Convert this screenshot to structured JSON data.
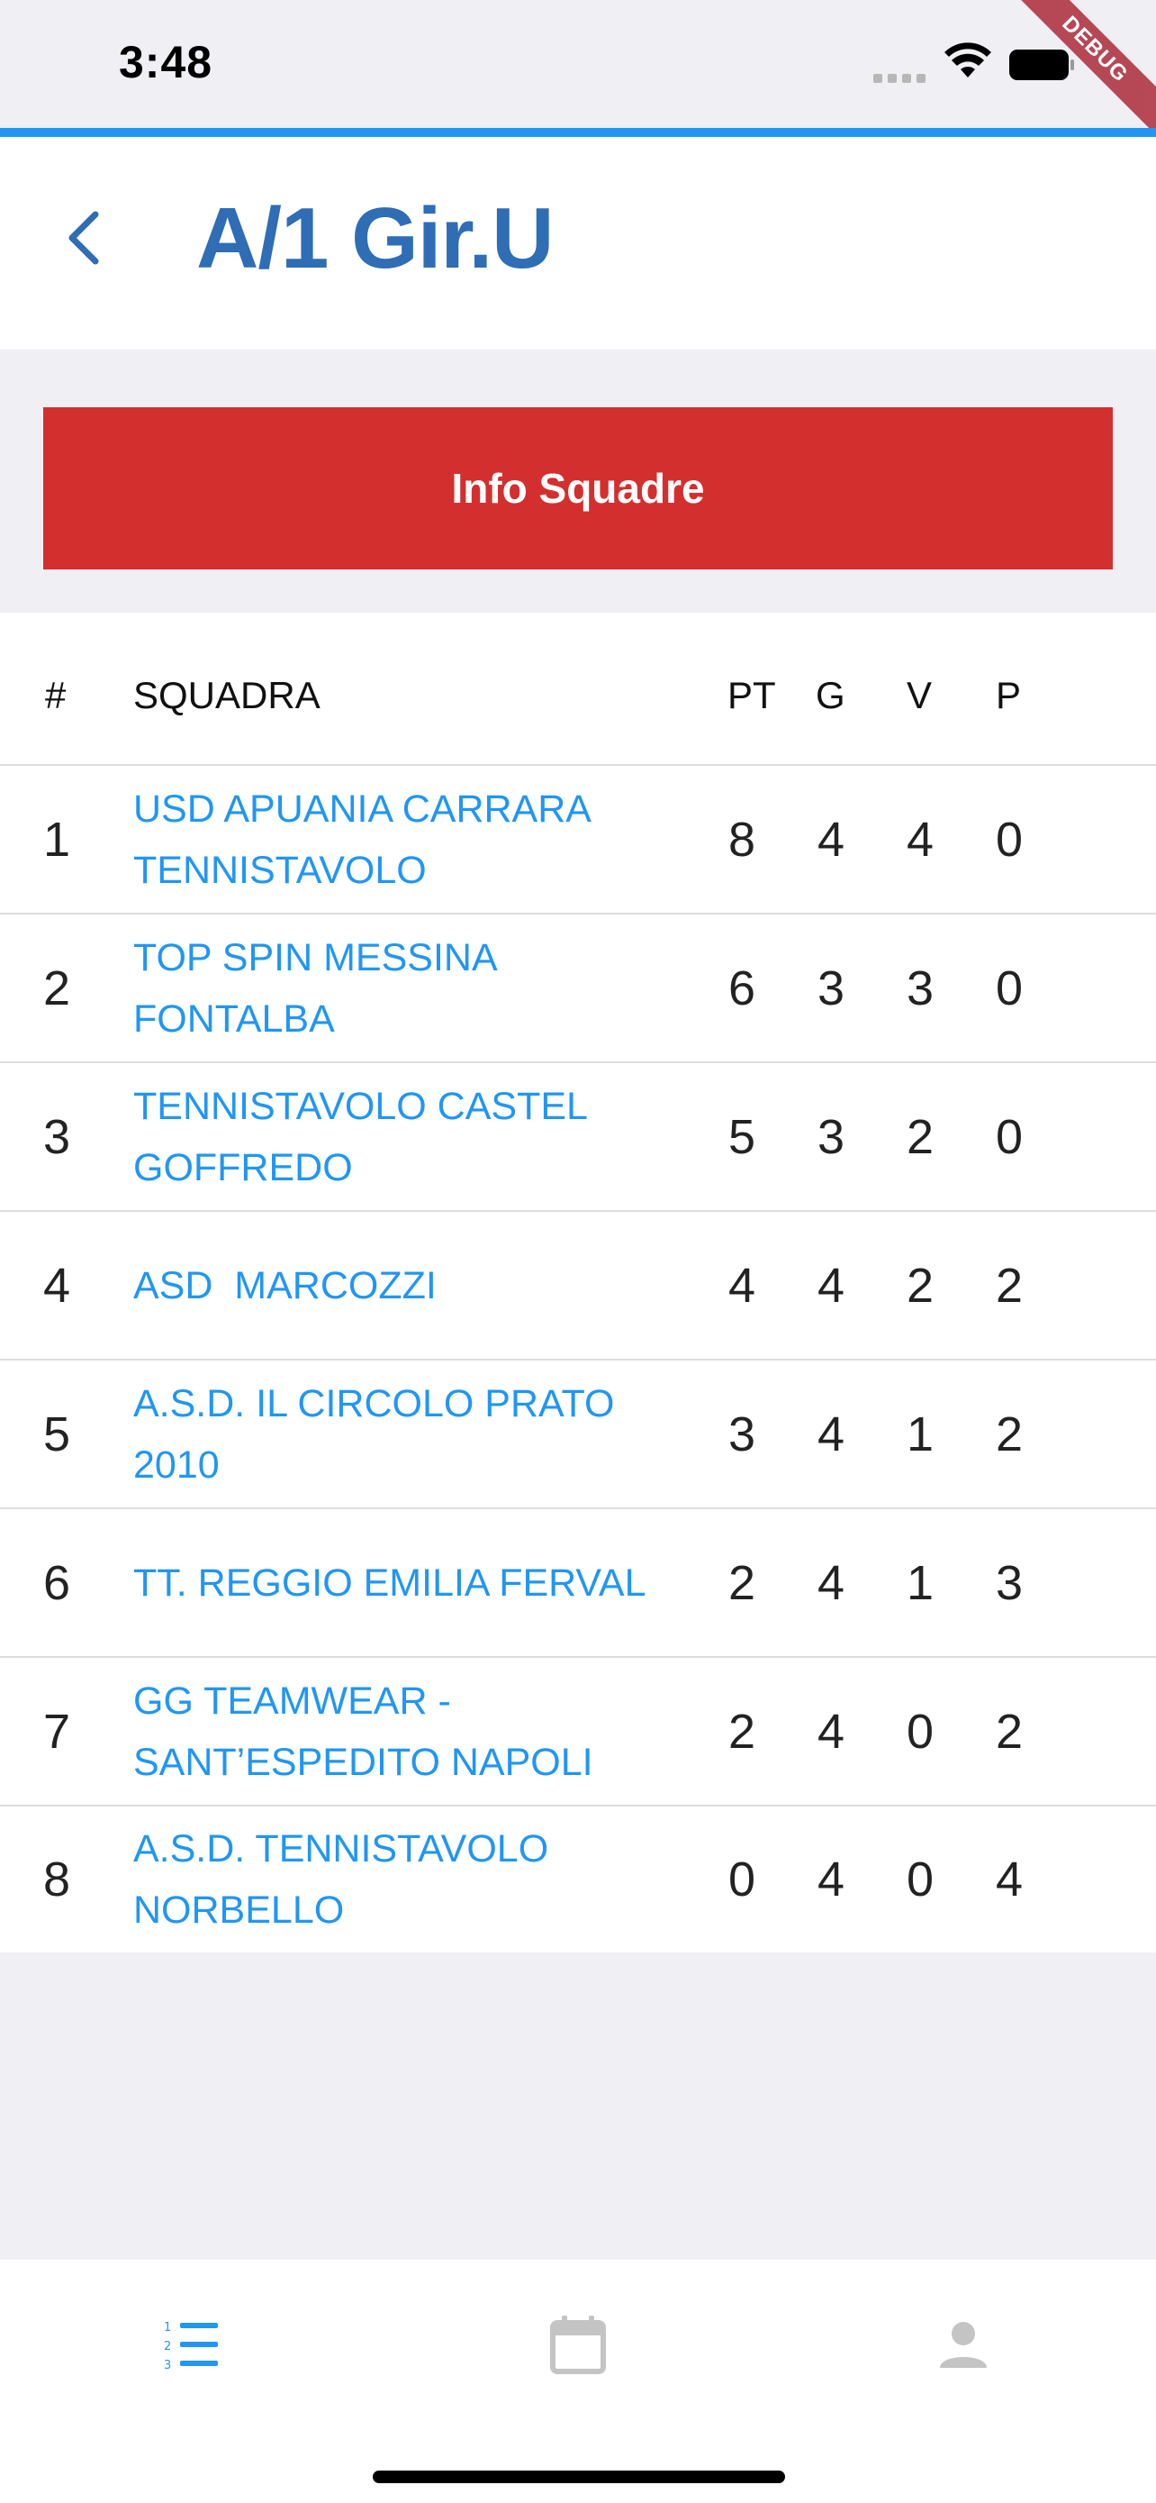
{
  "status_bar": {
    "time": "3:48",
    "debug_label": "DEBUG"
  },
  "header": {
    "title": "A/1 Gir.U"
  },
  "info_button": {
    "label": "Info Squadre"
  },
  "table": {
    "columns": {
      "pos": "#",
      "team": "SQUADRA",
      "pt": "PT",
      "g": "G",
      "v": "V",
      "p": "P"
    },
    "rows": [
      {
        "pos": "1",
        "team": "USD APUANIA CARRARA TENNISTAVOLO",
        "pt": "8",
        "g": "4",
        "v": "4",
        "p": "0"
      },
      {
        "pos": "2",
        "team": "TOP SPIN MESSINA FONTALBA",
        "pt": "6",
        "g": "3",
        "v": "3",
        "p": "0"
      },
      {
        "pos": "3",
        "team": "TENNISTAVOLO CASTEL GOFFREDO",
        "pt": "5",
        "g": "3",
        "v": "2",
        "p": "0"
      },
      {
        "pos": "4",
        "team": "ASD  MARCOZZI",
        "pt": "4",
        "g": "4",
        "v": "2",
        "p": "2"
      },
      {
        "pos": "5",
        "team": "A.S.D. IL CIRCOLO PRATO 2010",
        "pt": "3",
        "g": "4",
        "v": "1",
        "p": "2"
      },
      {
        "pos": "6",
        "team": "TT. REGGIO EMILIA FERVAL",
        "pt": "2",
        "g": "4",
        "v": "1",
        "p": "3"
      },
      {
        "pos": "7",
        "team": "GG TEAMWEAR - SANT’ESPEDITO NAPOLI",
        "pt": "2",
        "g": "4",
        "v": "0",
        "p": "2"
      },
      {
        "pos": "8",
        "team": "A.S.D. TENNISTAVOLO NORBELLO",
        "pt": "0",
        "g": "4",
        "v": "0",
        "p": "4"
      }
    ]
  },
  "bottom_nav": {
    "items": [
      {
        "icon": "standings-list-icon",
        "active": true
      },
      {
        "icon": "calendar-icon",
        "active": false
      },
      {
        "icon": "person-icon",
        "active": false
      }
    ]
  },
  "colors": {
    "accent": "#2196f3",
    "title": "#2f6db5",
    "button": "#d32f2f",
    "inactive_icon": "#c4c4c4"
  }
}
